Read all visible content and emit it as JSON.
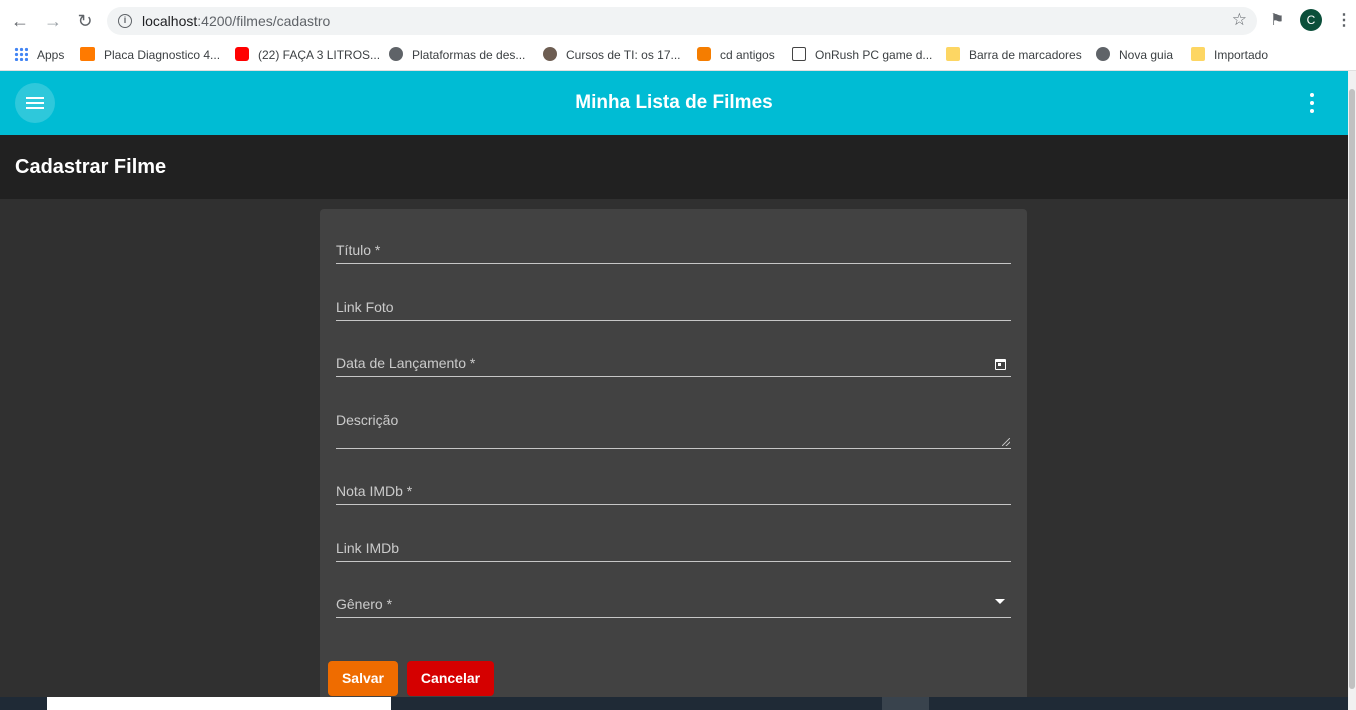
{
  "browser": {
    "url_host": "localhost",
    "url_path": ":4200/filmes/cadastro",
    "profile_initial": "C",
    "bookmarks": [
      {
        "label": "Apps"
      },
      {
        "label": "Placa Diagnostico 4..."
      },
      {
        "label": "(22) FAÇA 3 LITROS..."
      },
      {
        "label": "Plataformas de des..."
      },
      {
        "label": "Cursos de TI: os 17..."
      },
      {
        "label": "cd antigos"
      },
      {
        "label": "OnRush PC game d..."
      },
      {
        "label": "Barra de marcadores"
      },
      {
        "label": "Nova guia"
      },
      {
        "label": "Importado"
      }
    ]
  },
  "app": {
    "title": "Minha Lista de Filmes"
  },
  "page": {
    "title": "Cadastrar Filme"
  },
  "form": {
    "fields": [
      {
        "label": "Título *"
      },
      {
        "label": "Link Foto"
      },
      {
        "label": "Data de Lançamento *"
      },
      {
        "label": "Descrição"
      },
      {
        "label": "Nota IMDb *"
      },
      {
        "label": "Link IMDb"
      },
      {
        "label": "Gênero *"
      }
    ],
    "save_label": "Salvar",
    "cancel_label": "Cancelar"
  },
  "colors": {
    "toolbar": "#00bcd4",
    "save": "#ef6c00",
    "cancel": "#d50000",
    "card": "#424242",
    "background": "#303030"
  }
}
